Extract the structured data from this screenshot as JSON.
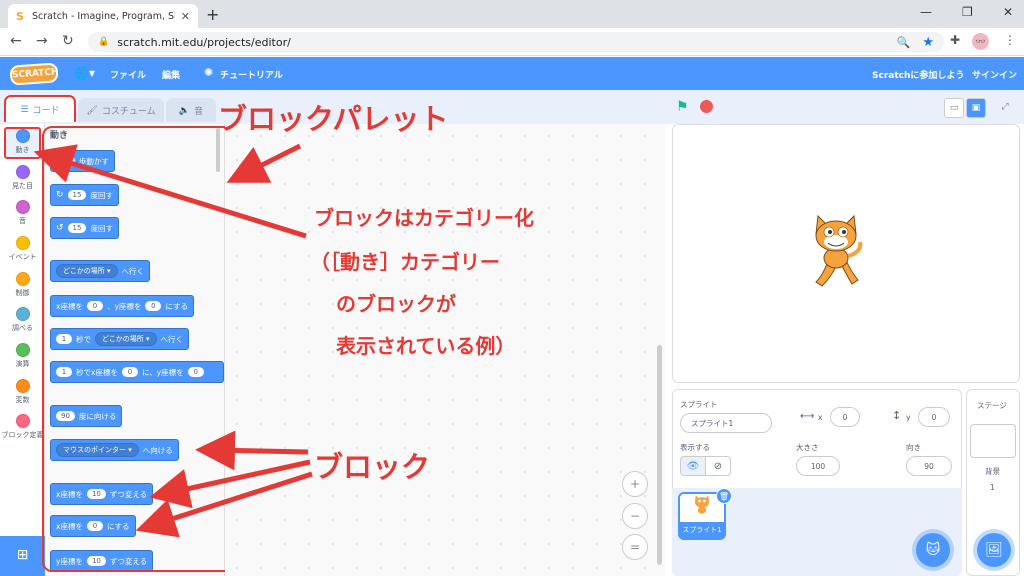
{
  "browser": {
    "tab_title": "Scratch - Imagine, Program, Shar",
    "tab_favicon": "S",
    "new_tab": "+",
    "url": "scratch.mit.edu/projects/editor/",
    "avatar": "👓"
  },
  "menubar": {
    "logo": "SCRATCH",
    "file": "ファイル",
    "edit": "編集",
    "tutorial": "チュートリアル",
    "join": "Scratchに参加しよう",
    "signin": "サインイン"
  },
  "tabs": {
    "code": "コード",
    "costume": "コスチューム",
    "sound": "音"
  },
  "categories": [
    {
      "label": "動き",
      "color": "#4c97ff"
    },
    {
      "label": "見た目",
      "color": "#9966ff"
    },
    {
      "label": "音",
      "color": "#cf63cf"
    },
    {
      "label": "イベント",
      "color": "#ffbf00"
    },
    {
      "label": "制御",
      "color": "#ffab19"
    },
    {
      "label": "調べる",
      "color": "#5cb1d6"
    },
    {
      "label": "演算",
      "color": "#59c059"
    },
    {
      "label": "変数",
      "color": "#ff8c1a"
    },
    {
      "label": "ブロック定義",
      "color": "#ff6680"
    }
  ],
  "palette": {
    "heading": "動き",
    "b1": {
      "num": "10",
      "text": "歩動かす"
    },
    "b2": {
      "num": "15",
      "text": "度回す"
    },
    "b3": {
      "num": "15",
      "text": "度回す"
    },
    "b4": {
      "drop": "どこかの場所",
      "text": "へ行く"
    },
    "b5": {
      "t1": "x座標を",
      "x": "0",
      "t2": "、y座標を",
      "y": "0",
      "t3": "にする"
    },
    "b6": {
      "num": "1",
      "t1": "秒で",
      "drop": "どこかの場所",
      "t2": "へ行く"
    },
    "b7": {
      "num": "1",
      "t1": "秒でx座標を",
      "x": "0",
      "t2": "に、y座標を",
      "y": "0"
    },
    "b8": {
      "num": "90",
      "text": "度に向ける"
    },
    "b9": {
      "drop": "マウスのポインター",
      "text": "へ向ける"
    },
    "b10": {
      "t1": "x座標を",
      "num": "10",
      "t2": "ずつ変える"
    },
    "b11": {
      "t1": "x座標を",
      "num": "0",
      "t2": "にする"
    },
    "b12": {
      "t1": "y座標を",
      "num": "10",
      "t2": "ずつ変える"
    }
  },
  "zoom": {
    "in": "+",
    "out": "−",
    "reset": "="
  },
  "sprite_info": {
    "sprite_label": "スプライト",
    "sprite_name": "スプライト1",
    "x_label": "x",
    "x": "0",
    "y_label": "y",
    "y": "0",
    "show_label": "表示する",
    "size_label": "大きさ",
    "size": "100",
    "direction_label": "向き",
    "direction": "90",
    "thumb_name": "スプライト1"
  },
  "stage_panel": {
    "title": "ステージ",
    "backdrop_label": "背景",
    "backdrop_count": "1"
  },
  "annotations": {
    "palette_title": "ブロックパレット",
    "category_note": [
      "ブロックはカテゴリー化",
      "（［動き］カテゴリー",
      "のブロックが",
      "表示されている例）"
    ],
    "block_title": "ブロック"
  },
  "colors": {
    "accent": "#4c97ff",
    "annotation": "#e53935",
    "motion": "#4c97ff"
  }
}
